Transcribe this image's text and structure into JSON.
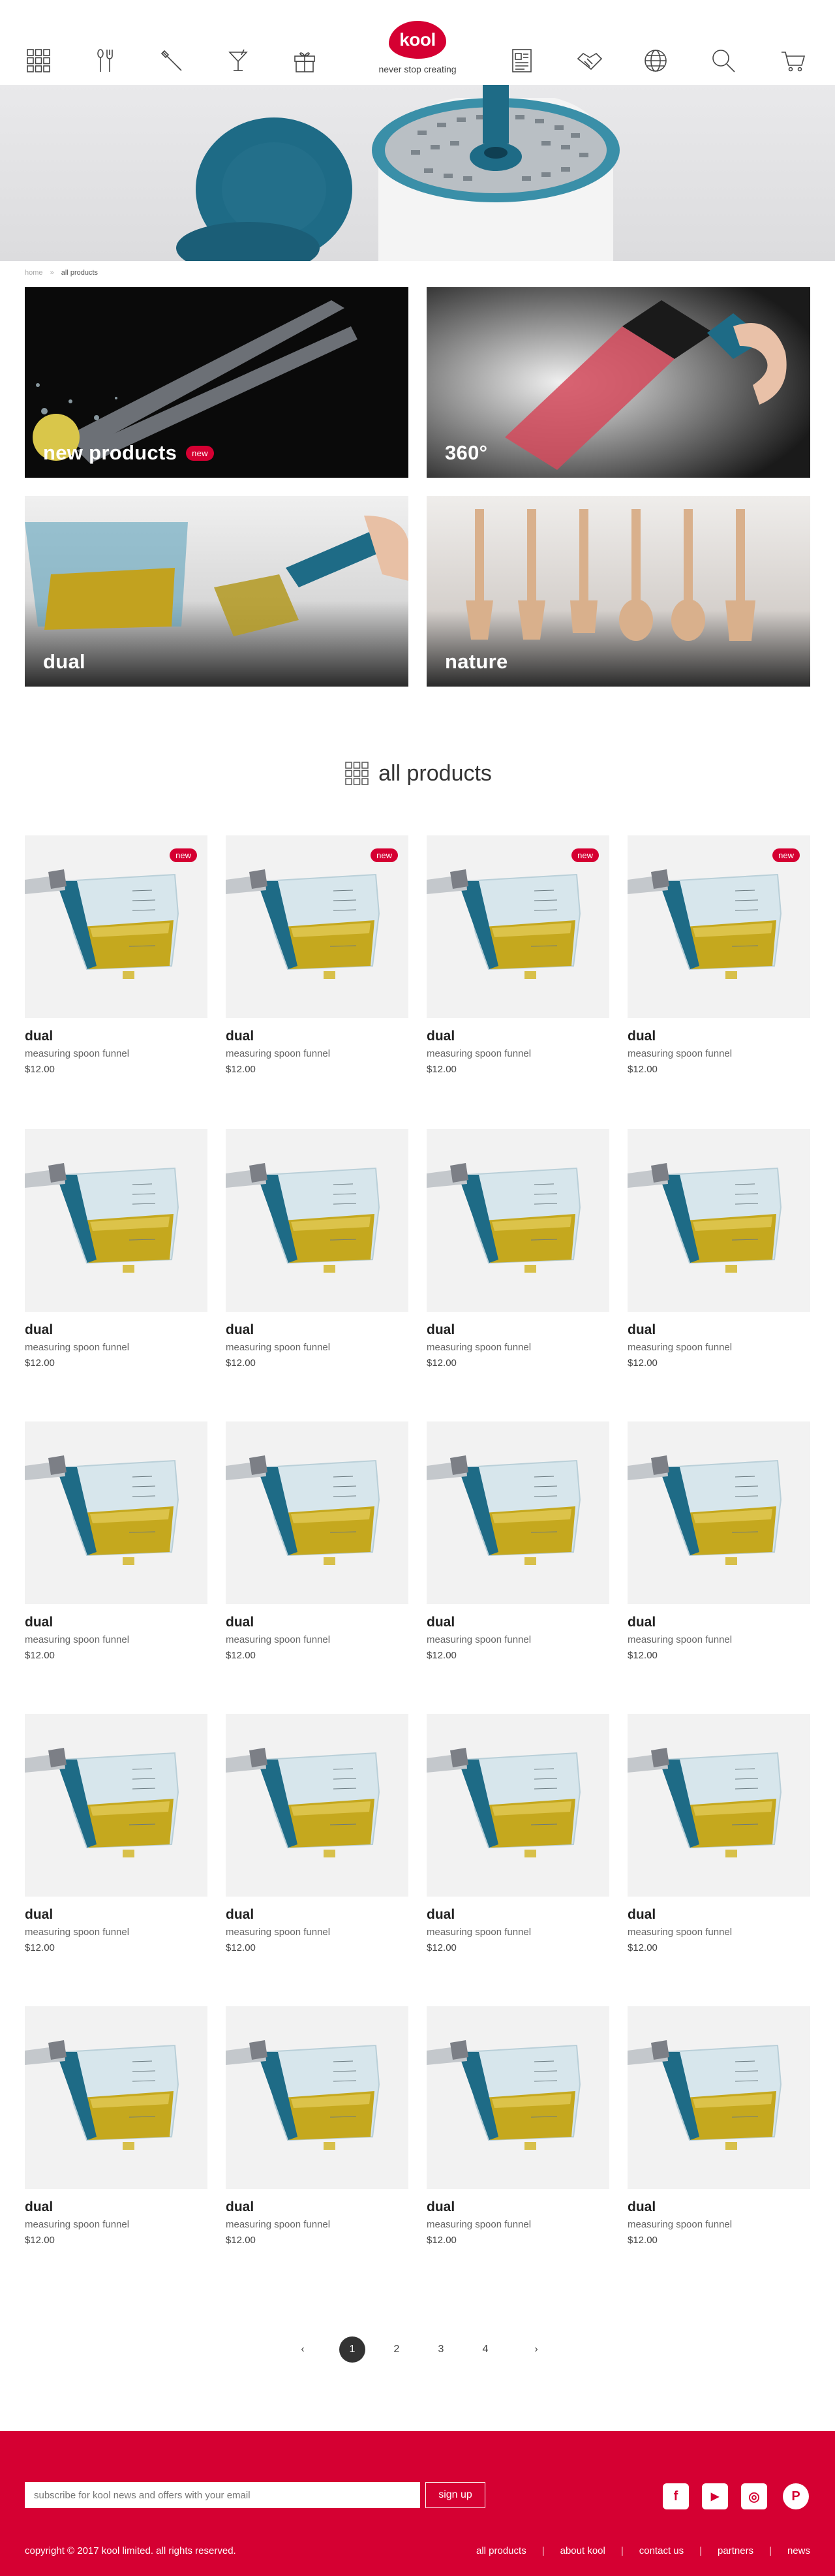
{
  "header": {
    "logo_text": "kool",
    "tagline": "never stop creating",
    "nav_left": [
      {
        "name": "all-products-icon"
      },
      {
        "name": "utensils-icon"
      },
      {
        "name": "tools-icon"
      },
      {
        "name": "cocktail-icon"
      },
      {
        "name": "gift-icon"
      }
    ],
    "nav_right": [
      {
        "name": "catalog-icon"
      },
      {
        "name": "partners-icon"
      },
      {
        "name": "globe-icon"
      },
      {
        "name": "search-icon"
      },
      {
        "name": "cart-icon"
      }
    ]
  },
  "breadcrumb": {
    "home": "home",
    "separator": "»",
    "current": "all products"
  },
  "tiles": [
    {
      "label": "new products",
      "badge": "new"
    },
    {
      "label": "360°",
      "badge": ""
    },
    {
      "label": "dual",
      "badge": ""
    },
    {
      "label": "nature",
      "badge": ""
    }
  ],
  "section": {
    "title": "all products"
  },
  "products": [
    {
      "name": "dual",
      "desc": "measuring spoon funnel",
      "price": "$12.00",
      "badge": "new"
    },
    {
      "name": "dual",
      "desc": "measuring spoon funnel",
      "price": "$12.00",
      "badge": "new"
    },
    {
      "name": "dual",
      "desc": "measuring spoon funnel",
      "price": "$12.00",
      "badge": "new"
    },
    {
      "name": "dual",
      "desc": "measuring spoon funnel",
      "price": "$12.00",
      "badge": "new"
    },
    {
      "name": "dual",
      "desc": "measuring spoon funnel",
      "price": "$12.00",
      "badge": ""
    },
    {
      "name": "dual",
      "desc": "measuring spoon funnel",
      "price": "$12.00",
      "badge": ""
    },
    {
      "name": "dual",
      "desc": "measuring spoon funnel",
      "price": "$12.00",
      "badge": ""
    },
    {
      "name": "dual",
      "desc": "measuring spoon funnel",
      "price": "$12.00",
      "badge": ""
    },
    {
      "name": "dual",
      "desc": "measuring spoon funnel",
      "price": "$12.00",
      "badge": ""
    },
    {
      "name": "dual",
      "desc": "measuring spoon funnel",
      "price": "$12.00",
      "badge": ""
    },
    {
      "name": "dual",
      "desc": "measuring spoon funnel",
      "price": "$12.00",
      "badge": ""
    },
    {
      "name": "dual",
      "desc": "measuring spoon funnel",
      "price": "$12.00",
      "badge": ""
    },
    {
      "name": "dual",
      "desc": "measuring spoon funnel",
      "price": "$12.00",
      "badge": ""
    },
    {
      "name": "dual",
      "desc": "measuring spoon funnel",
      "price": "$12.00",
      "badge": ""
    },
    {
      "name": "dual",
      "desc": "measuring spoon funnel",
      "price": "$12.00",
      "badge": ""
    },
    {
      "name": "dual",
      "desc": "measuring spoon funnel",
      "price": "$12.00",
      "badge": ""
    },
    {
      "name": "dual",
      "desc": "measuring spoon funnel",
      "price": "$12.00",
      "badge": ""
    },
    {
      "name": "dual",
      "desc": "measuring spoon funnel",
      "price": "$12.00",
      "badge": ""
    },
    {
      "name": "dual",
      "desc": "measuring spoon funnel",
      "price": "$12.00",
      "badge": ""
    },
    {
      "name": "dual",
      "desc": "measuring spoon funnel",
      "price": "$12.00",
      "badge": ""
    }
  ],
  "pagination": {
    "prev": "‹",
    "pages": [
      "1",
      "2",
      "3",
      "4"
    ],
    "current": "1",
    "next": "›"
  },
  "footer": {
    "subscribe_placeholder": "subscribe for kool news and offers with your email",
    "signup_label": "sign up",
    "social": [
      {
        "name": "facebook-icon",
        "glyph": "f"
      },
      {
        "name": "youtube-icon",
        "glyph": "▶"
      },
      {
        "name": "instagram-icon",
        "glyph": "◎"
      },
      {
        "name": "pinterest-icon",
        "glyph": "P"
      }
    ],
    "copyright": "copyright © 2017 kool limited. all rights reserved.",
    "links": [
      "all products",
      "about kool",
      "contact us",
      "partners",
      "news"
    ]
  },
  "colors": {
    "brand": "#d50032",
    "teal": "#1e6b86",
    "card_bg": "#f2f2f2"
  }
}
